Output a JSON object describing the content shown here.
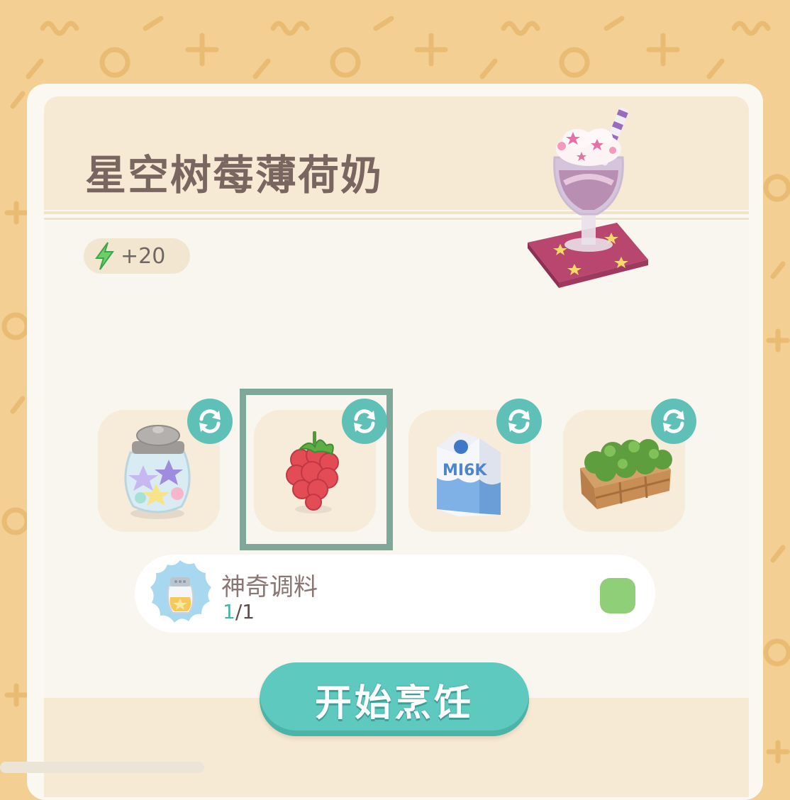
{
  "recipe": {
    "title": "星空树莓薄荷奶",
    "energy_bonus": "+20",
    "dish_icon": "starry-milkshake-icon"
  },
  "ingredients": [
    {
      "name": "star-candy-jar-icon",
      "swap_icon": "swap-icon"
    },
    {
      "name": "raspberry-icon",
      "swap_icon": "swap-icon",
      "selected": true
    },
    {
      "name": "milk-carton-icon",
      "swap_icon": "swap-icon"
    },
    {
      "name": "mint-crate-icon",
      "swap_icon": "swap-icon"
    }
  ],
  "seasoning": {
    "name": "神奇调料",
    "have": "1",
    "total": "/1",
    "icon": "magic-seasoning-jar-icon",
    "status_color": "#8fcf77"
  },
  "actions": {
    "cook_label": "开始烹饪"
  },
  "colors": {
    "background": "#f3cf93",
    "accent": "#5ec9bf",
    "selection_frame": "#7fa89a"
  }
}
